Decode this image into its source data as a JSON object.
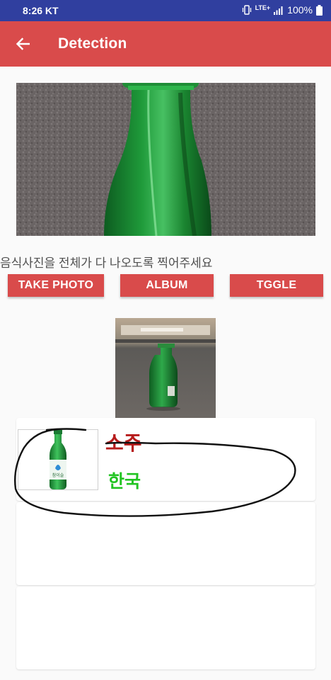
{
  "status_bar": {
    "time": "8:26",
    "carrier": "KT",
    "network": "LTE+",
    "battery": "100%"
  },
  "app_bar": {
    "title": "Detection"
  },
  "instruction": "음식사진을 전체가 다 나오도록 찍어주세요",
  "buttons": {
    "take_photo": "TAKE PHOTO",
    "album": "ALBUM",
    "toggle": "TGGLE"
  },
  "results": [
    {
      "name": "소주",
      "origin": "한국"
    }
  ],
  "colors": {
    "status_bar": "#303f9f",
    "app_bar": "#d94b4b",
    "button": "#d94b4b",
    "food_name": "#b71c1c",
    "food_origin": "#22c422"
  }
}
